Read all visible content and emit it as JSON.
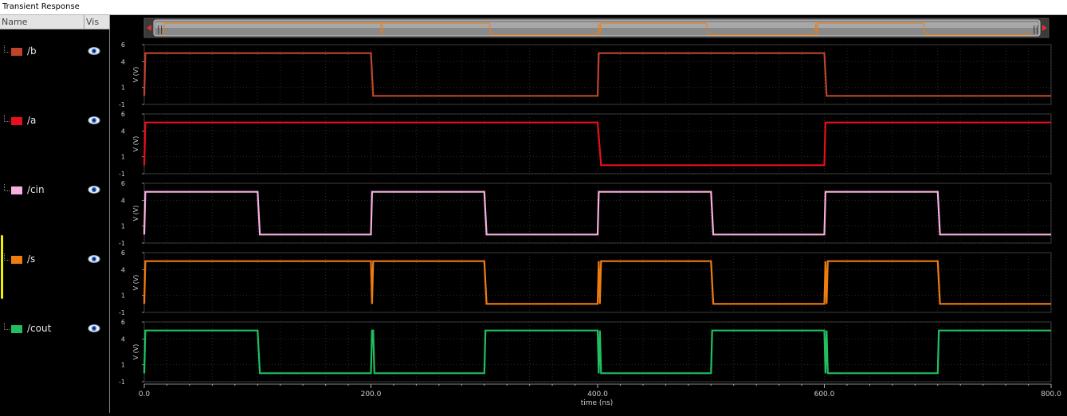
{
  "window": {
    "title": "Transient Response"
  },
  "panel": {
    "col_name": "Name",
    "col_vis": "Vis",
    "signals": [
      {
        "name": "/b",
        "color": "#c0442a",
        "vis_icon": "eye-icon",
        "selected": false
      },
      {
        "name": "/a",
        "color": "#e8101a",
        "vis_icon": "eye-icon",
        "selected": false
      },
      {
        "name": "/cin",
        "color": "#f8b0e0",
        "vis_icon": "eye-icon",
        "selected": false
      },
      {
        "name": "/s",
        "color": "#f07c10",
        "vis_icon": "eye-icon",
        "selected": true
      },
      {
        "name": "/cout",
        "color": "#20c060",
        "vis_icon": "eye-icon",
        "selected": false
      }
    ]
  },
  "chart_data": {
    "type": "line",
    "xlabel": "time (ns)",
    "ylabel": "V (V)",
    "xlim": [
      0,
      800
    ],
    "ylim": [
      -1,
      6
    ],
    "x_ticks": [
      "0.0",
      "200.0",
      "400.0",
      "600.0",
      "800.0"
    ],
    "y_ticks": [
      "6",
      "4",
      "1",
      "-1"
    ],
    "grid": true,
    "series": [
      {
        "name": "/b",
        "color": "#c0442a",
        "x": [
          0,
          1,
          200,
          202,
          400,
          401,
          600,
          602,
          800
        ],
        "y": [
          0,
          5,
          5,
          0,
          0,
          5,
          5,
          0,
          0
        ]
      },
      {
        "name": "/a",
        "color": "#e8101a",
        "x": [
          0,
          1,
          400,
          403,
          600,
          601,
          800
        ],
        "y": [
          0,
          5,
          5,
          0,
          0,
          5,
          5
        ]
      },
      {
        "name": "/cin",
        "color": "#f8b0e0",
        "x": [
          0,
          1,
          100,
          102,
          200,
          201,
          300,
          302,
          400,
          401,
          500,
          502,
          600,
          601,
          700,
          702,
          800
        ],
        "y": [
          0,
          5,
          5,
          0,
          0,
          5,
          5,
          0,
          0,
          5,
          5,
          0,
          0,
          5,
          5,
          0,
          0
        ]
      },
      {
        "name": "/s",
        "color": "#f07c10",
        "x": [
          0,
          1,
          200,
          201,
          202,
          203,
          300,
          302,
          400,
          401,
          402,
          403,
          404,
          500,
          502,
          600,
          601,
          602,
          603,
          700,
          702,
          800
        ],
        "y": [
          0,
          5,
          5,
          0,
          5,
          5,
          5,
          0,
          0,
          5,
          0,
          5,
          5,
          5,
          0,
          0,
          5,
          0,
          5,
          5,
          0,
          0
        ]
      },
      {
        "name": "/cout",
        "color": "#20c060",
        "x": [
          0,
          1,
          100,
          102,
          200,
          201,
          202,
          203,
          204,
          300,
          301,
          400,
          401,
          402,
          403,
          404,
          500,
          501,
          600,
          601,
          602,
          603,
          604,
          700,
          701,
          800
        ],
        "y": [
          0,
          5,
          5,
          0,
          0,
          5,
          5,
          0,
          0,
          0,
          5,
          5,
          0,
          5,
          0,
          0,
          0,
          5,
          5,
          0,
          5,
          0,
          0,
          0,
          5,
          5
        ]
      }
    ]
  }
}
